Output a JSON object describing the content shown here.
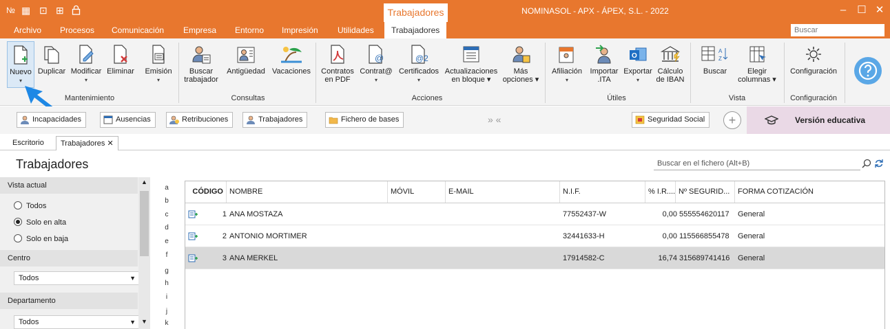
{
  "titlebar": {
    "quick_access": [
      "№",
      "▦",
      "⊡",
      "⊞",
      "🔒"
    ],
    "context_tab": "Trabajadores",
    "app_title": "NOMINASOL - APX - ÁPEX, S.L. - 2022",
    "window_buttons": [
      "–",
      "☐",
      "✕"
    ]
  },
  "menu": {
    "items": [
      "Archivo",
      "Procesos",
      "Comunicación",
      "Empresa",
      "Entorno",
      "Impresión",
      "Utilidades",
      "Trabajadores"
    ],
    "search_placeholder": "Buscar"
  },
  "ribbon": {
    "buttons": {
      "nuevo": "Nuevo",
      "duplicar": "Duplicar",
      "modificar": "Modificar",
      "eliminar": "Eliminar",
      "emision": "Emisión",
      "buscar_trabajador_1": "Buscar",
      "buscar_trabajador_2": "trabajador",
      "antiguedad": "Antigüedad",
      "vacaciones": "Vacaciones",
      "contratos_1": "Contratos",
      "contratos_2": "en PDF",
      "contrat_arroba": "Contrat@",
      "certificados": "Certificados",
      "actualizaciones_1": "Actualizaciones",
      "actualizaciones_2": "en bloque ▾",
      "mas_1": "Más",
      "mas_2": "opciones ▾",
      "afiliacion": "Afiliación",
      "importar_1": "Importar",
      "importar_2": ".ITA",
      "exportar": "Exportar",
      "calculo_1": "Cálculo",
      "calculo_2": "de IBAN",
      "buscar": "Buscar",
      "elegir_1": "Elegir",
      "elegir_2": "columnas ▾",
      "configuracion": "Configuración"
    },
    "groups": {
      "mantenimiento": "Mantenimiento",
      "consultas": "Consultas",
      "acciones": "Acciones",
      "utiles": "Útiles",
      "vista": "Vista",
      "configuracion": "Configuración"
    }
  },
  "quickbar": {
    "buttons": [
      "Incapacidades",
      "Ausencias",
      "Retribuciones",
      "Trabajadores",
      "Fichero de bases"
    ],
    "nav_arrows": "»  «",
    "seguridad_social": "Seguridad Social",
    "add": "+",
    "edition": "Versión educativa"
  },
  "doc_tabs": {
    "escritorio": "Escritorio",
    "trabajadores": "Trabajadores ✕"
  },
  "page": {
    "title": "Trabajadores",
    "search_placeholder": "Buscar en el fichero (Alt+B)"
  },
  "sidebar": {
    "vista_actual": "Vista actual",
    "options": [
      "Todos",
      "Solo en alta",
      "Solo en baja"
    ],
    "selected_option": "Solo en alta",
    "centro": "Centro",
    "centro_value": "Todos",
    "departamento": "Departamento",
    "departamento_value": "Todos"
  },
  "alphabet": [
    "a",
    "b",
    "c",
    "d",
    "e",
    "f",
    "g",
    "h",
    "i",
    "j",
    "k"
  ],
  "table": {
    "columns": [
      "CÓDIGO",
      "NOMBRE",
      "MÓVIL",
      "E-MAIL",
      "N.I.F.",
      "% I.R....",
      "Nº SEGURID...",
      "FORMA COTIZACIÓN"
    ],
    "rows": [
      {
        "codigo": "1",
        "nombre": "ANA MOSTAZA",
        "movil": "",
        "email": "",
        "nif": "77552437-W",
        "irpf": "0,00",
        "nss": "555554620117",
        "forma": "General"
      },
      {
        "codigo": "2",
        "nombre": "ANTONIO MORTIMER",
        "movil": "",
        "email": "",
        "nif": "32441633-H",
        "irpf": "0,00",
        "nss": "115566855478",
        "forma": "General"
      },
      {
        "codigo": "3",
        "nombre": "ANA MERKEL",
        "movil": "",
        "email": "",
        "nif": "17914582-C",
        "irpf": "16,74",
        "nss": "315689741416",
        "forma": "General"
      }
    ],
    "selected_row": 3
  },
  "colors": {
    "accent": "#e8772e",
    "ribbon_bg": "#f3f3f3",
    "help_circle": "#5aa7e6",
    "education_bg": "#ead9e6",
    "pointer_arrow": "#1e88e5"
  }
}
